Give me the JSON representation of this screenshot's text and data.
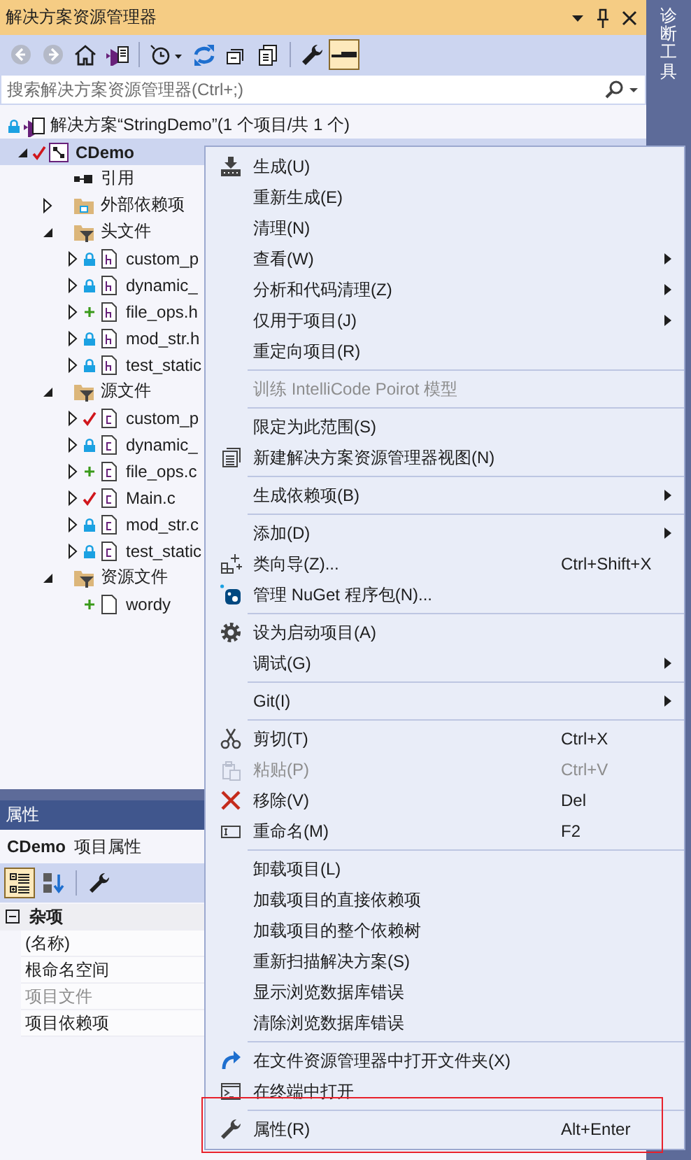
{
  "window": {
    "title": "解决方案资源管理器"
  },
  "toolbar": [
    {
      "kind": "back",
      "disabled": true,
      "on": false
    },
    {
      "kind": "forward",
      "disabled": true,
      "on": false
    },
    {
      "kind": "home",
      "disabled": false,
      "on": false
    },
    {
      "kind": "switch-views",
      "disabled": false,
      "on": false
    },
    {
      "kind": "separator"
    },
    {
      "kind": "history",
      "disabled": false,
      "on": false
    },
    {
      "kind": "refresh",
      "disabled": false,
      "on": false
    },
    {
      "kind": "collapse",
      "disabled": false,
      "on": false
    },
    {
      "kind": "copy",
      "disabled": false,
      "on": false
    },
    {
      "kind": "separator"
    },
    {
      "kind": "wrench",
      "disabled": false,
      "on": false
    },
    {
      "kind": "preview",
      "disabled": false,
      "on": true
    }
  ],
  "search": {
    "placeholder": "搜索解决方案资源管理器(Ctrl+;)"
  },
  "tree": [
    {
      "label": "解决方案“StringDemo”(1 个项目/共 1 个)",
      "kind": "solution",
      "locked": true,
      "edited": false,
      "added": false,
      "selected": false,
      "children": [
        {
          "label": "CDemo",
          "kind": "project",
          "locked": false,
          "edited": true,
          "added": false,
          "expanded": true,
          "selected": true,
          "children": [
            {
              "label": "引用",
              "kind": "references",
              "locked": false,
              "edited": false,
              "added": false,
              "selected": false
            },
            {
              "label": "外部依赖项",
              "kind": "external",
              "locked": false,
              "edited": false,
              "added": false,
              "expanded": false,
              "selected": false
            },
            {
              "label": "头文件",
              "kind": "filter",
              "locked": false,
              "edited": false,
              "added": false,
              "expanded": true,
              "selected": false,
              "children": [
                {
                  "label": "custom_p",
                  "kind": "header",
                  "locked": true,
                  "edited": false,
                  "added": false,
                  "expanded": false,
                  "selected": false
                },
                {
                  "label": "dynamic_",
                  "kind": "header",
                  "locked": true,
                  "edited": false,
                  "added": false,
                  "expanded": false,
                  "selected": false
                },
                {
                  "label": "file_ops.h",
                  "kind": "header",
                  "locked": false,
                  "edited": false,
                  "added": true,
                  "expanded": false,
                  "selected": false
                },
                {
                  "label": "mod_str.h",
                  "kind": "header",
                  "locked": true,
                  "edited": false,
                  "added": false,
                  "expanded": false,
                  "selected": false
                },
                {
                  "label": "test_static",
                  "kind": "header",
                  "locked": true,
                  "edited": false,
                  "added": false,
                  "expanded": false,
                  "selected": false
                }
              ]
            },
            {
              "label": "源文件",
              "kind": "filter",
              "locked": false,
              "edited": false,
              "added": false,
              "expanded": true,
              "selected": false,
              "children": [
                {
                  "label": "custom_p",
                  "kind": "source",
                  "locked": false,
                  "edited": true,
                  "added": false,
                  "expanded": false,
                  "selected": false
                },
                {
                  "label": "dynamic_",
                  "kind": "source",
                  "locked": true,
                  "edited": false,
                  "added": false,
                  "expanded": false,
                  "selected": false
                },
                {
                  "label": "file_ops.c",
                  "kind": "source",
                  "locked": false,
                  "edited": false,
                  "added": true,
                  "expanded": false,
                  "selected": false
                },
                {
                  "label": "Main.c",
                  "kind": "source",
                  "locked": false,
                  "edited": true,
                  "added": false,
                  "expanded": false,
                  "selected": false
                },
                {
                  "label": "mod_str.c",
                  "kind": "source",
                  "locked": true,
                  "edited": false,
                  "added": false,
                  "expanded": false,
                  "selected": false
                },
                {
                  "label": "test_static",
                  "kind": "source",
                  "locked": true,
                  "edited": false,
                  "added": false,
                  "expanded": false,
                  "selected": false
                }
              ]
            },
            {
              "label": "资源文件",
              "kind": "filter",
              "locked": false,
              "edited": false,
              "added": false,
              "expanded": true,
              "selected": false,
              "children": [
                {
                  "label": "wordy",
                  "kind": "file",
                  "locked": false,
                  "edited": false,
                  "added": true,
                  "selected": false
                }
              ]
            }
          ]
        }
      ]
    }
  ],
  "properties": {
    "title": "属性",
    "subject": "CDemo",
    "subject_type": "项目属性",
    "toolbar": [
      {
        "kind": "categorized",
        "on": true
      },
      {
        "kind": "alphabetical",
        "on": false
      },
      {
        "kind": "pages",
        "on": false
      }
    ],
    "category": {
      "label": "杂项",
      "expanded": true,
      "rows": [
        {
          "name": "(名称)",
          "disabled": false
        },
        {
          "name": "根命名空间",
          "disabled": false
        },
        {
          "name": "项目文件",
          "disabled": true
        },
        {
          "name": "项目依赖项",
          "disabled": false
        }
      ]
    }
  },
  "context_menu": [
    {
      "kind": "build",
      "label": "生成(U)",
      "submenu": false,
      "disabled": false
    },
    {
      "kind": "plain",
      "label": "重新生成(E)",
      "submenu": false,
      "disabled": false
    },
    {
      "kind": "plain",
      "label": "清理(N)",
      "submenu": false,
      "disabled": false
    },
    {
      "kind": "plain",
      "label": "查看(W)",
      "submenu": true,
      "disabled": false
    },
    {
      "kind": "plain",
      "label": "分析和代码清理(Z)",
      "submenu": true,
      "disabled": false
    },
    {
      "kind": "plain",
      "label": "仅用于项目(J)",
      "submenu": true,
      "disabled": false
    },
    {
      "kind": "plain",
      "label": "重定向项目(R)",
      "submenu": false,
      "disabled": false
    },
    {
      "kind": "separator"
    },
    {
      "kind": "plain",
      "label": "训练 IntelliCode Poirot 模型",
      "submenu": false,
      "disabled": true
    },
    {
      "kind": "separator"
    },
    {
      "kind": "plain",
      "label": "限定为此范围(S)",
      "submenu": false,
      "disabled": false
    },
    {
      "kind": "new-view",
      "label": "新建解决方案资源管理器视图(N)",
      "submenu": false,
      "disabled": false
    },
    {
      "kind": "separator"
    },
    {
      "kind": "plain",
      "label": "生成依赖项(B)",
      "submenu": true,
      "disabled": false
    },
    {
      "kind": "separator"
    },
    {
      "kind": "plain",
      "label": "添加(D)",
      "submenu": true,
      "disabled": false
    },
    {
      "kind": "class-wizard",
      "label": "类向导(Z)...",
      "shortcut": "Ctrl+Shift+X",
      "submenu": false,
      "disabled": false
    },
    {
      "kind": "package",
      "label": "管理 NuGet 程序包(N)...",
      "submenu": false,
      "disabled": false
    },
    {
      "kind": "separator"
    },
    {
      "kind": "gear",
      "label": "设为启动项目(A)",
      "submenu": false,
      "disabled": false
    },
    {
      "kind": "plain",
      "label": "调试(G)",
      "submenu": true,
      "disabled": false
    },
    {
      "kind": "separator"
    },
    {
      "kind": "plain",
      "label": "Git(I)",
      "submenu": true,
      "disabled": false
    },
    {
      "kind": "separator"
    },
    {
      "kind": "cut",
      "label": "剪切(T)",
      "shortcut": "Ctrl+X",
      "submenu": false,
      "disabled": false
    },
    {
      "kind": "paste",
      "label": "粘贴(P)",
      "shortcut": "Ctrl+V",
      "submenu": false,
      "disabled": true
    },
    {
      "kind": "remove",
      "label": "移除(V)",
      "shortcut": "Del",
      "submenu": false,
      "disabled": false
    },
    {
      "kind": "rename",
      "label": "重命名(M)",
      "shortcut": "F2",
      "submenu": false,
      "disabled": false
    },
    {
      "kind": "separator"
    },
    {
      "kind": "plain",
      "label": "卸载项目(L)",
      "submenu": false,
      "disabled": false
    },
    {
      "kind": "plain",
      "label": "加载项目的直接依赖项",
      "submenu": false,
      "disabled": false
    },
    {
      "kind": "plain",
      "label": "加载项目的整个依赖树",
      "submenu": false,
      "disabled": false
    },
    {
      "kind": "plain",
      "label": "重新扫描解决方案(S)",
      "submenu": false,
      "disabled": false
    },
    {
      "kind": "plain",
      "label": "显示浏览数据库错误",
      "submenu": false,
      "disabled": false
    },
    {
      "kind": "plain",
      "label": "清除浏览数据库错误",
      "submenu": false,
      "disabled": false
    },
    {
      "kind": "separator"
    },
    {
      "kind": "open-folder",
      "label": "在文件资源管理器中打开文件夹(X)",
      "submenu": false,
      "disabled": false
    },
    {
      "kind": "terminal",
      "label": "在终端中打开",
      "submenu": false,
      "disabled": false
    },
    {
      "kind": "separator"
    },
    {
      "kind": "wrench",
      "label": "属性(R)",
      "shortcut": "Alt+Enter",
      "submenu": false,
      "disabled": false
    }
  ],
  "side_tab": {
    "label": "诊断工具"
  }
}
